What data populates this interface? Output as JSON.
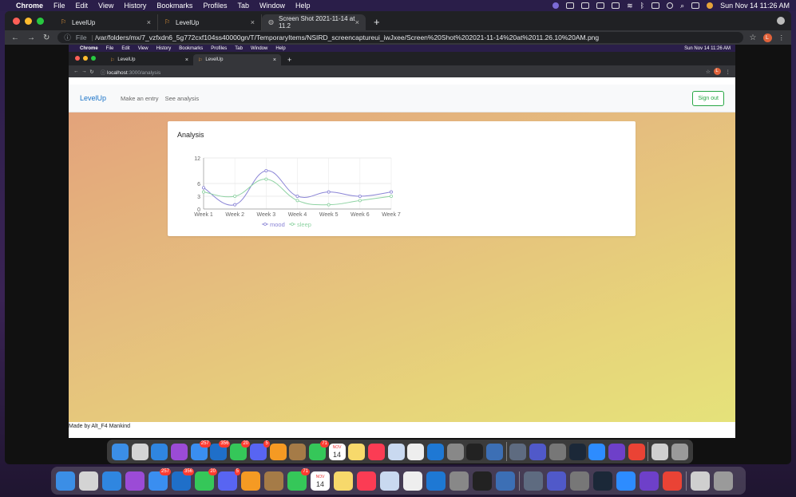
{
  "os_menubar": {
    "app": "Chrome",
    "items": [
      "File",
      "Edit",
      "View",
      "History",
      "Bookmarks",
      "Profiles",
      "Tab",
      "Window",
      "Help"
    ],
    "clock": "Sun Nov 14  11:26 AM"
  },
  "outer_browser": {
    "tabs": [
      {
        "label": "LevelUp"
      },
      {
        "label": "LevelUp"
      },
      {
        "label": "Screen Shot 2021-11-14 at 11.2"
      }
    ],
    "address_prefix": "File",
    "url": "/var/folders/mx/7_vzfxdn6_5g772cxf104ss40000gn/T/TemporaryItems/NSIRD_screencaptureui_iwJxee/Screen%20Shot%202021-11-14%20at%2011.26.10%20AM.png",
    "profile_initial": "L"
  },
  "inner_screenshot": {
    "menubar": {
      "app": "Chrome",
      "items": [
        "File",
        "Edit",
        "View",
        "History",
        "Bookmarks",
        "Profiles",
        "Tab",
        "Window",
        "Help"
      ],
      "clock": "Sun Nov 14  11:26 AM"
    },
    "tabs": [
      {
        "label": "LevelUp"
      },
      {
        "label": "LevelUp"
      }
    ],
    "url_host": "localhost",
    "url_path": ":3000/analysis",
    "profile_initial": "L"
  },
  "app": {
    "brand": "LevelUp",
    "nav": [
      "Make an entry",
      "See analysis"
    ],
    "signout_label": "Sign out",
    "card_title": "Analysis",
    "footer": "Made by Alt_F4 Mankind",
    "accent": "#1a73c8",
    "button_color": "#28a745"
  },
  "chart_data": {
    "type": "line",
    "categories": [
      "Week 1",
      "Week 2",
      "Week 3",
      "Week 4",
      "Week 5",
      "Week 6",
      "Week 7"
    ],
    "series": [
      {
        "name": "mood",
        "values": [
          5,
          1,
          9,
          3,
          4,
          3,
          4
        ],
        "color": "#8a84d6"
      },
      {
        "name": "sleep",
        "values": [
          4,
          3,
          7,
          2,
          1,
          2,
          3
        ],
        "color": "#8fd3a3"
      }
    ],
    "yticks": [
      0,
      3,
      6,
      12
    ],
    "ylim": [
      0,
      12
    ],
    "grid": true,
    "legend": "bottom"
  },
  "dock_icons": [
    "finder-icon",
    "launchpad-icon",
    "safari-icon",
    "podcasts-icon",
    "mail-icon",
    "outlook-icon",
    "facetime-icon",
    "discord-icon",
    "pages-icon",
    "notes-brown-icon",
    "messages-icon",
    "calendar-icon",
    "notes-icon",
    "music-icon",
    "preview-icon",
    "textedit-icon",
    "vscode-icon",
    "settings-icon",
    "terminal-icon",
    "virtualbox-icon",
    "screenshot-icon",
    "teams-icon",
    "tex-icon",
    "steam-icon",
    "zoom-icon",
    "github-icon",
    "chrome-icon",
    "documents-icon",
    "trash-icon"
  ],
  "dock_badges": {
    "mail": "257",
    "outlook": "356",
    "facetime": "20",
    "discord": "5",
    "messages": "71"
  },
  "calendar": {
    "month": "NOV",
    "day": "14"
  }
}
